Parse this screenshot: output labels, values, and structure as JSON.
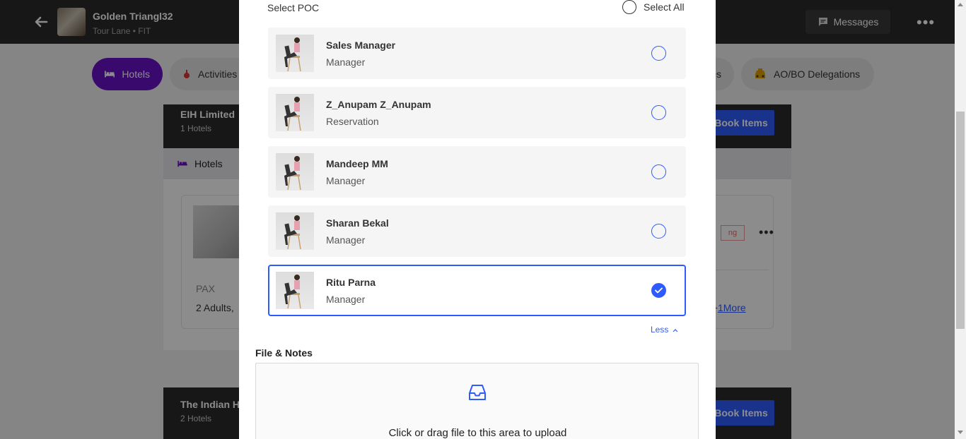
{
  "header": {
    "trip_title": "Golden Triangl32",
    "trip_subtitle": "Tour Lane • FIT",
    "messages_label": "Messages"
  },
  "tabs": [
    {
      "label": "Hotels",
      "active": true
    },
    {
      "label": "Activities",
      "active": false
    },
    {
      "label": "es",
      "active": false
    },
    {
      "label": "AO/BO Delegations",
      "active": false
    }
  ],
  "cards": [
    {
      "name": "EIH Limited",
      "count": "1 Hotels",
      "book_label": "Book Items",
      "section": "Hotels"
    },
    {
      "name": "The Indian H",
      "count": "2 Hotels",
      "book_label": "Book Items"
    }
  ],
  "hotel": {
    "pax_label": "PAX",
    "pax_value": "2 Adults,",
    "status_tag": "ng",
    "more_prefix": "p+",
    "more_link": "1More"
  },
  "modal": {
    "select_poc_label": "Select POC",
    "select_all_label": "Select All",
    "pocs": [
      {
        "name": "Sales Manager",
        "role": "Manager",
        "selected": false
      },
      {
        "name": "Z_Anupam Z_Anupam",
        "role": "Reservation",
        "selected": false
      },
      {
        "name": "Mandeep MM",
        "role": "Manager",
        "selected": false
      },
      {
        "name": "Sharan Bekal",
        "role": "Manager",
        "selected": false
      },
      {
        "name": "Ritu Parna",
        "role": "Manager",
        "selected": true
      }
    ],
    "less_label": "Less",
    "files_title": "File & Notes",
    "upload_text": "Click or drag file to this area to upload"
  },
  "colors": {
    "accent": "#2e5bff",
    "tab_active": "#6a12c7",
    "topbar": "#2b2b2b"
  }
}
